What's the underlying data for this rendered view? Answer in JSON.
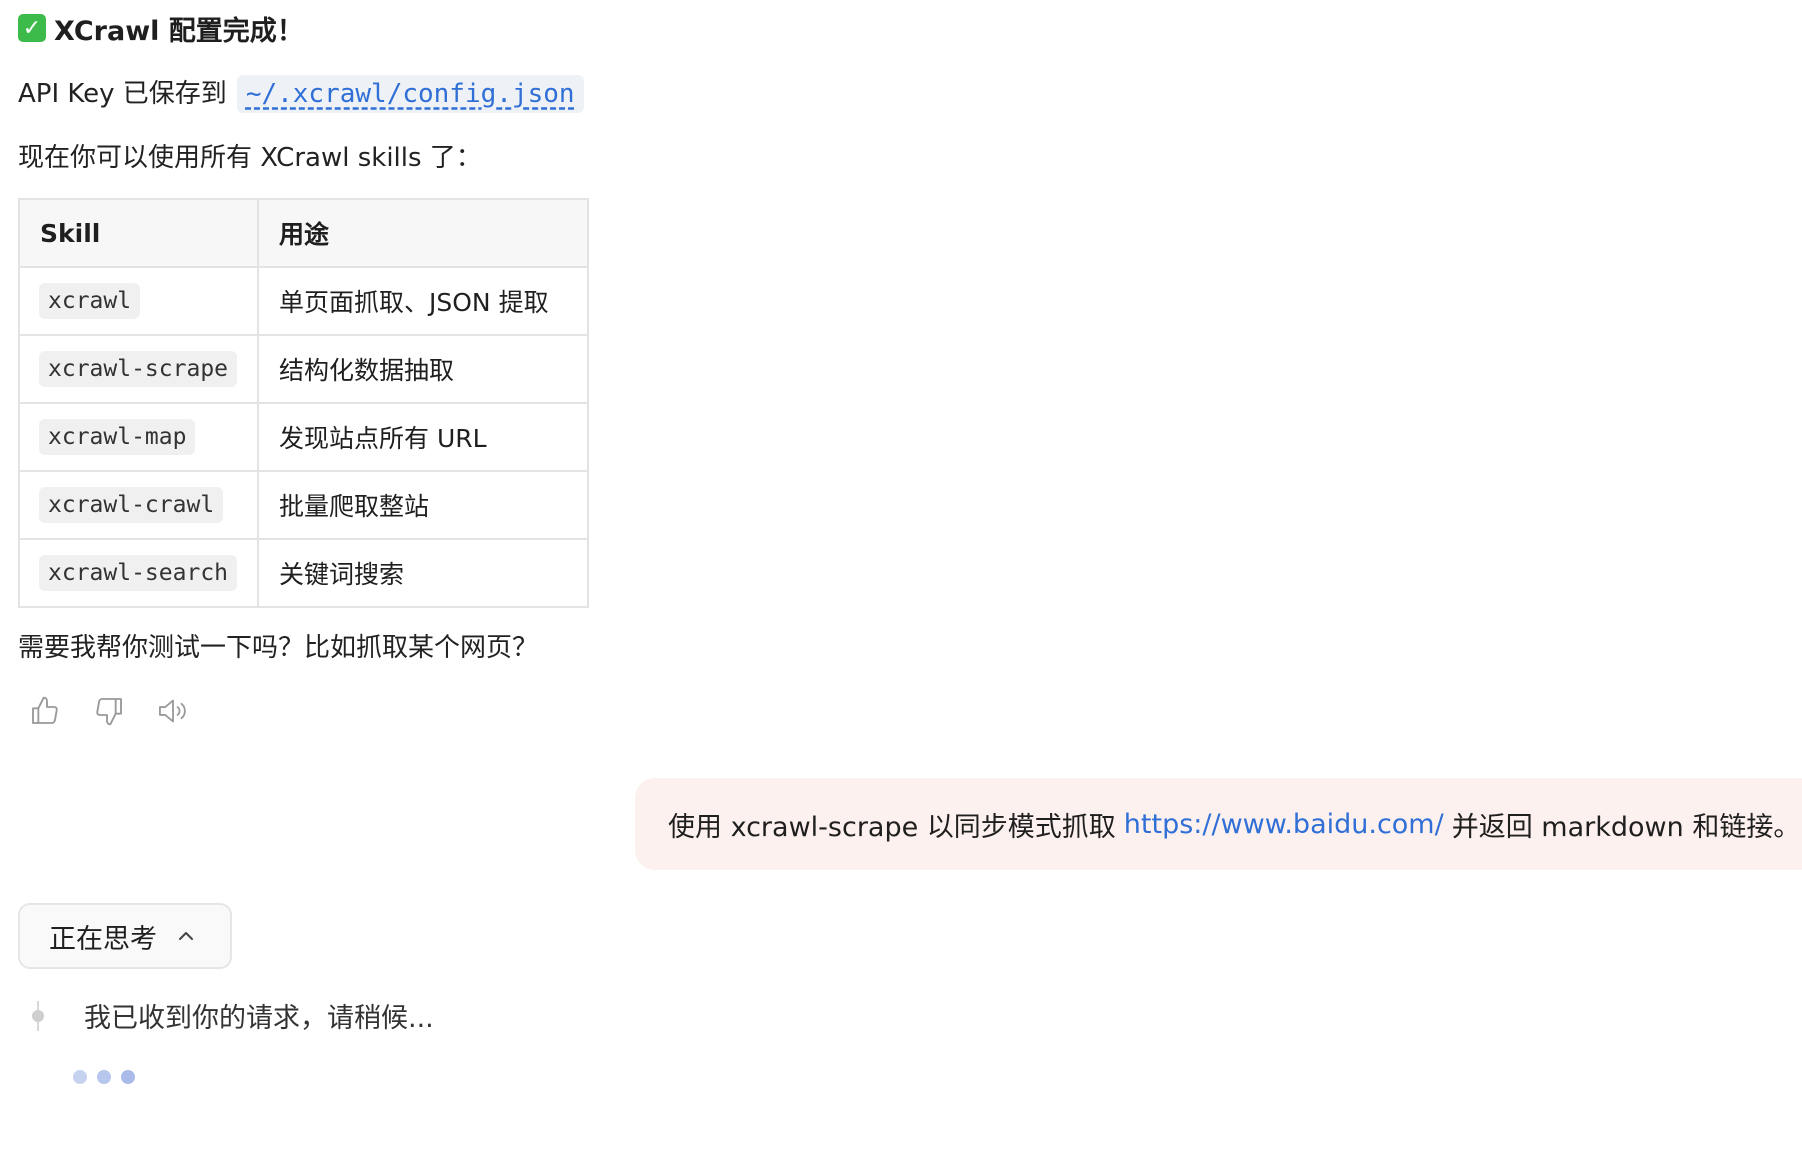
{
  "assistant_message": {
    "title": "XCrawl 配置完成！",
    "api_key_text": "API Key 已保存到",
    "config_path": "~/.xcrawl/config.json",
    "intro": "现在你可以使用所有 XCrawl skills 了：",
    "table": {
      "headers": [
        "Skill",
        "用途"
      ],
      "rows": [
        {
          "skill": "xcrawl",
          "purpose": "单页面抓取、JSON 提取"
        },
        {
          "skill": "xcrawl-scrape",
          "purpose": "结构化数据抽取"
        },
        {
          "skill": "xcrawl-map",
          "purpose": "发现站点所有 URL"
        },
        {
          "skill": "xcrawl-crawl",
          "purpose": "批量爬取整站"
        },
        {
          "skill": "xcrawl-search",
          "purpose": "关键词搜索"
        }
      ]
    },
    "question": "需要我帮你测试一下吗？比如抓取某个网页？",
    "actions": [
      "thumbs-up-icon",
      "thumbs-down-icon",
      "speaker-icon"
    ]
  },
  "user_message": {
    "prefix": "使用 xcrawl-scrape 以同步模式抓取",
    "link": "https://www.baidu.com/",
    "suffix": "并返回 markdown 和链接。"
  },
  "thinking": {
    "label": "正在思考",
    "status_text": "我已收到你的请求，请稍候..."
  },
  "colors": {
    "accent_link": "#2f6fd6",
    "user_bubble_bg": "#fdf1ef",
    "success_check": "#3dbb4a"
  }
}
